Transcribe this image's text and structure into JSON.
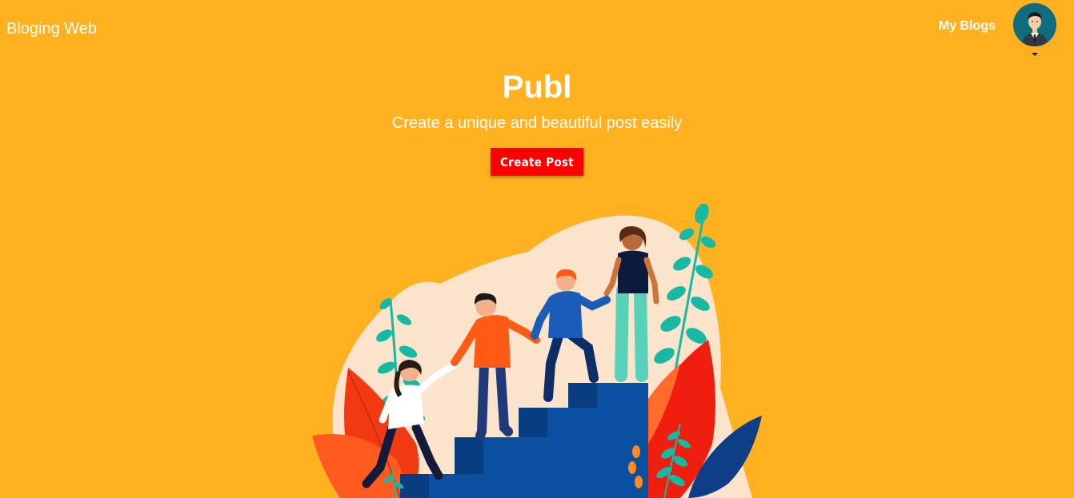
{
  "nav": {
    "brand": "Bloging Web",
    "my_blogs": "My Blogs",
    "avatar_icon": "user-avatar-icon",
    "caret_icon": "caret-down-icon"
  },
  "hero": {
    "title": "Publ",
    "subtitle": "Create a unique and beautiful post easily",
    "cta_label": "Create Post"
  },
  "illustration": {
    "name": "people-climbing-stairs-illustration"
  },
  "colors": {
    "background": "#FFB120",
    "cta": "#FF0000",
    "text": "#FFFFFF",
    "avatar_bg": "#0F6E7E",
    "stairs": "#0B4FA0",
    "blob": "#FBE3CC"
  }
}
